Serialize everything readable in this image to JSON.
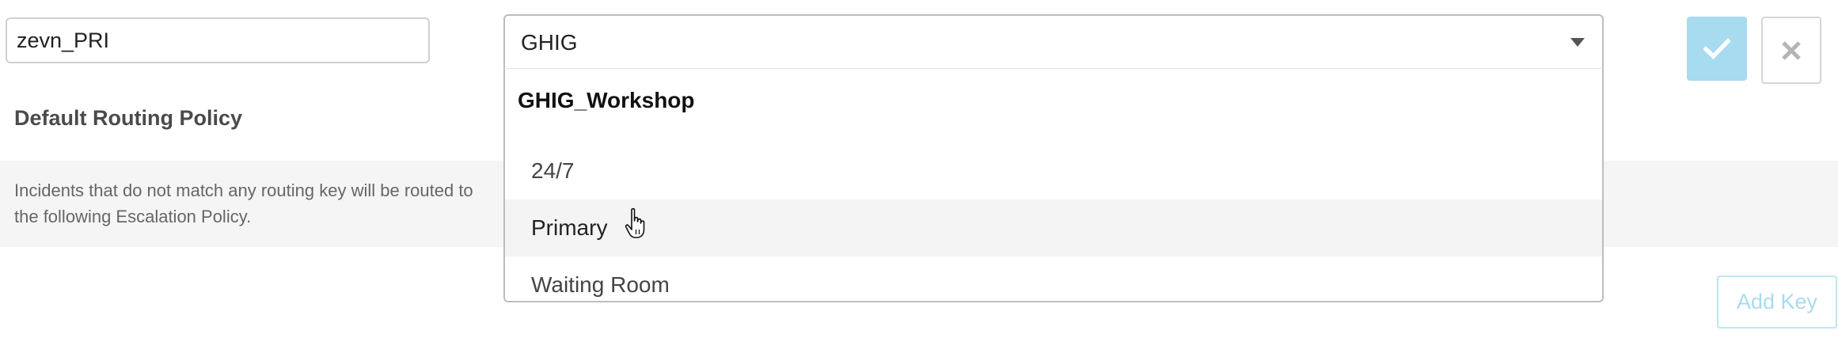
{
  "routing_key": {
    "value": "zevn_PRI"
  },
  "default_policy": {
    "heading": "Default Routing Policy",
    "description": "Incidents that do not match any routing key will be routed to the following Escalation Policy."
  },
  "escalation_select": {
    "selected_value": "GHIG",
    "group_label": "GHIG_Workshop",
    "options": [
      {
        "label": "24/7"
      },
      {
        "label": "Primary"
      },
      {
        "label": "Waiting Room"
      }
    ],
    "hovered_option": "Primary"
  },
  "actions": {
    "confirm_icon": "check-icon",
    "cancel_icon": "close-icon",
    "add_key_label": "Add Key"
  },
  "colors": {
    "confirm_bg": "#a6dbf0",
    "add_key_text": "#a9dbef",
    "band_bg": "#f5f5f5"
  }
}
